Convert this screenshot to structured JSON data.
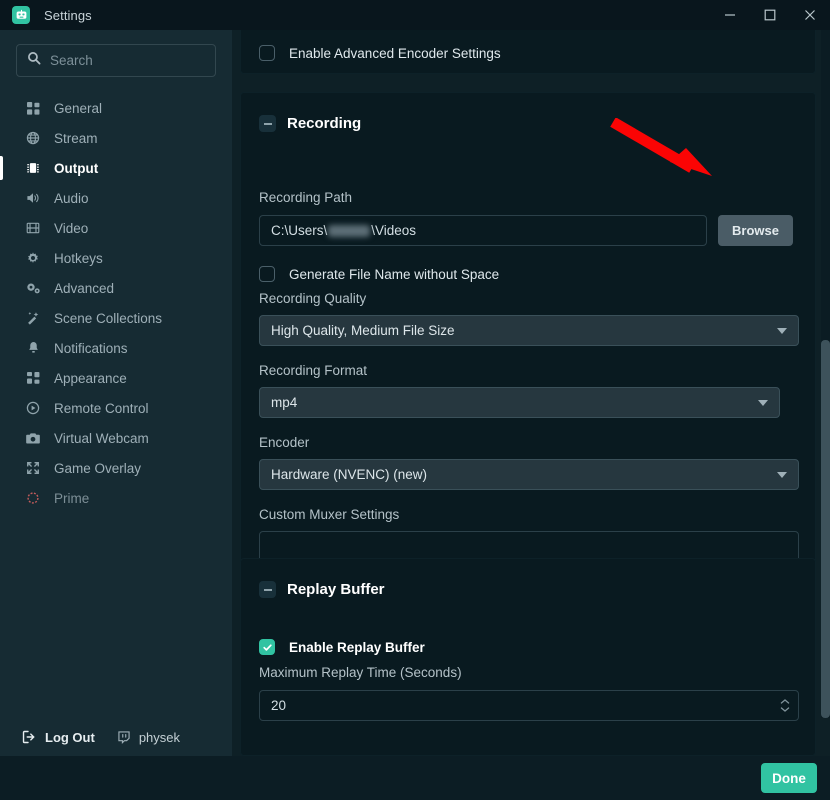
{
  "window": {
    "title": "Settings",
    "app_icon": "streamlabs-logo-icon",
    "minimize_label": "Minimize",
    "maximize_label": "Maximize",
    "close_label": "Close",
    "accent_color": "#31c3a2",
    "background_color": "#0e2026",
    "sidebar_color": "#162b33"
  },
  "search": {
    "placeholder": "Search",
    "value": "",
    "icon": "search-icon"
  },
  "sidebar": {
    "items": [
      {
        "label": "General",
        "icon": "grid-icon",
        "active": false
      },
      {
        "label": "Stream",
        "icon": "globe-icon",
        "active": false
      },
      {
        "label": "Output",
        "icon": "chip-icon",
        "active": true
      },
      {
        "label": "Audio",
        "icon": "speaker-icon",
        "active": false
      },
      {
        "label": "Video",
        "icon": "film-icon",
        "active": false
      },
      {
        "label": "Hotkeys",
        "icon": "gear-icon",
        "active": false
      },
      {
        "label": "Advanced",
        "icon": "gears-icon",
        "active": false
      },
      {
        "label": "Scene Collections",
        "icon": "wand-icon",
        "active": false
      },
      {
        "label": "Notifications",
        "icon": "bell-icon",
        "active": false
      },
      {
        "label": "Appearance",
        "icon": "layout-icon",
        "active": false
      },
      {
        "label": "Remote Control",
        "icon": "play-circle-icon",
        "active": false
      },
      {
        "label": "Virtual Webcam",
        "icon": "camera-icon",
        "active": false
      },
      {
        "label": "Game Overlay",
        "icon": "expand-icon",
        "active": false
      },
      {
        "label": "Prime",
        "icon": "prime-crown-icon",
        "active": false
      }
    ]
  },
  "bottom_bar": {
    "logout_label": "Log Out",
    "logout_icon": "logout-icon",
    "user_name": "physek",
    "user_icon": "twitch-icon"
  },
  "main": {
    "advanced_encoder": {
      "checkbox_label": "Enable Advanced Encoder Settings",
      "checked": false
    },
    "recording": {
      "section_title": "Recording",
      "collapse_icon": "collapse-minus-icon",
      "path_label": "Recording Path",
      "path_value_prefix": "C:\\Users\\",
      "path_value_suffix": "\\Videos",
      "path_redacted": true,
      "browse_label": "Browse",
      "generate_name_label": "Generate File Name without Space",
      "generate_name_checked": false,
      "quality_label": "Recording Quality",
      "quality_value": "High Quality, Medium File Size",
      "format_label": "Recording Format",
      "format_value": "mp4",
      "encoder_label": "Encoder",
      "encoder_value": "Hardware (NVENC) (new)",
      "muxer_label": "Custom Muxer Settings",
      "muxer_value": "",
      "dropdown_icon": "chevron-down-icon"
    },
    "replay_buffer": {
      "section_title": "Replay Buffer",
      "collapse_icon": "collapse-minus-icon",
      "enable_label": "Enable Replay Buffer",
      "enable_checked": true,
      "max_time_label": "Maximum Replay Time (Seconds)",
      "max_time_value": "20",
      "stepper_icon": "stepper-arrows-icon"
    }
  },
  "footer": {
    "done_label": "Done"
  },
  "annotation": {
    "arrow_color": "#fb0404",
    "arrow_target": "browse-button",
    "arrow_icon": "red-arrow-icon"
  }
}
